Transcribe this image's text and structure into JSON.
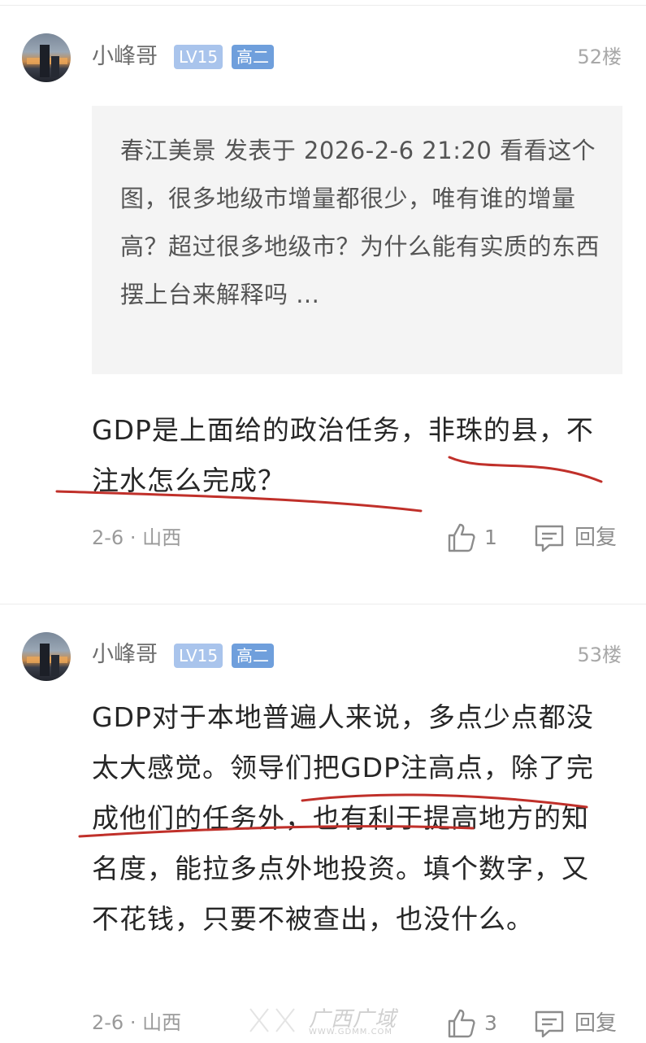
{
  "posts": [
    {
      "username": "小峰哥",
      "level": "LV15",
      "grade": "高二",
      "floor": "52楼",
      "quote": "春江美景 发表于 2026-2-6 21:20 看看这个图，很多地级市增量都很少，唯有谁的增量高？超过很多地级市？为什么能有实质的东西摆上台来解释吗 ...",
      "body": "GDP是上面给的政治任务，非珠的县，不注水怎么完成？",
      "date_location": "2-6 · 山西",
      "likes": "1",
      "reply_label": "回复"
    },
    {
      "username": "小峰哥",
      "level": "LV15",
      "grade": "高二",
      "floor": "53楼",
      "body": "GDP对于本地普遍人来说，多点少点都没太大感觉。领导们把GDP注高点，除了完成他们的任务外，也有利于提高地方的知名度，能拉多点外地投资。填个数字，又不花钱，只要不被查出，也没什么。",
      "date_location": "2-6 · 山西",
      "likes": "3",
      "reply_label": "回复"
    }
  ],
  "watermark": {
    "text": "广西广域",
    "url": "WWW.GDMM.COM"
  },
  "colors": {
    "level_badge": "#a9c4ec",
    "grade_badge": "#6f9fdc",
    "quote_bg": "#f4f4f4",
    "underline": "#c0302a"
  },
  "icons": [
    "thumbs-up-icon",
    "comment-icon",
    "avatar-image"
  ]
}
